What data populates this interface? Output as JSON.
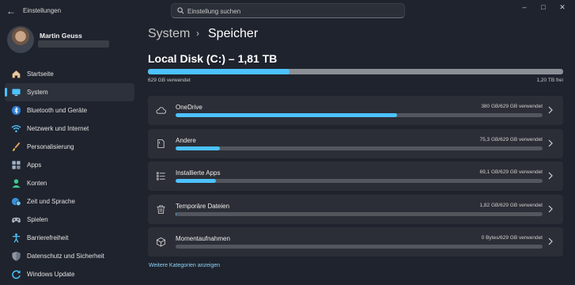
{
  "app": {
    "title": "Einstellungen"
  },
  "search": {
    "placeholder": "Einstellung suchen"
  },
  "user": {
    "name": "Martin Geuss"
  },
  "nav": {
    "items": [
      {
        "label": "Startseite",
        "icon": "home-icon",
        "active": false
      },
      {
        "label": "System",
        "icon": "monitor-icon",
        "active": true
      },
      {
        "label": "Bluetooth und Geräte",
        "icon": "bluetooth-icon",
        "active": false
      },
      {
        "label": "Netzwerk und Internet",
        "icon": "wifi-icon",
        "active": false
      },
      {
        "label": "Personalisierung",
        "icon": "brush-icon",
        "active": false
      },
      {
        "label": "Apps",
        "icon": "apps-icon",
        "active": false
      },
      {
        "label": "Konten",
        "icon": "person-icon",
        "active": false
      },
      {
        "label": "Zeit und Sprache",
        "icon": "globe-clock-icon",
        "active": false
      },
      {
        "label": "Spielen",
        "icon": "gamepad-icon",
        "active": false
      },
      {
        "label": "Barrierefreiheit",
        "icon": "accessibility-icon",
        "active": false
      },
      {
        "label": "Datenschutz und Sicherheit",
        "icon": "shield-icon",
        "active": false
      },
      {
        "label": "Windows Update",
        "icon": "update-icon",
        "active": false
      }
    ]
  },
  "breadcrumb": {
    "parent": "System",
    "separator": "›",
    "current": "Speicher"
  },
  "disk": {
    "title": "Local Disk (C:) – 1,81 TB",
    "used_label": "629 GB verwendet",
    "free_label": "1,20 TB frei",
    "used_fraction": 0.34
  },
  "categories": [
    {
      "name": "OneDrive",
      "usage": "380 GB/629 GB verwendet",
      "fraction": 0.604,
      "icon": "cloud-icon"
    },
    {
      "name": "Andere",
      "usage": "75,3 GB/629 GB verwendet",
      "fraction": 0.12,
      "icon": "document-icon"
    },
    {
      "name": "Installierte Apps",
      "usage": "69,1 GB/629 GB verwendet",
      "fraction": 0.11,
      "icon": "list-icon"
    },
    {
      "name": "Temporäre Dateien",
      "usage": "1,82 GB/629 GB verwendet",
      "fraction": 0.003,
      "icon": "trash-icon"
    },
    {
      "name": "Momentaufnahmen",
      "usage": "0 Bytes/629 GB verwendet",
      "fraction": 0.0,
      "icon": "cube-icon"
    }
  ],
  "more_link": "Weitere Kategorien anzeigen",
  "colors": {
    "accent": "#4cc2ff",
    "background": "#1f232d",
    "card": "#2b2e36"
  }
}
